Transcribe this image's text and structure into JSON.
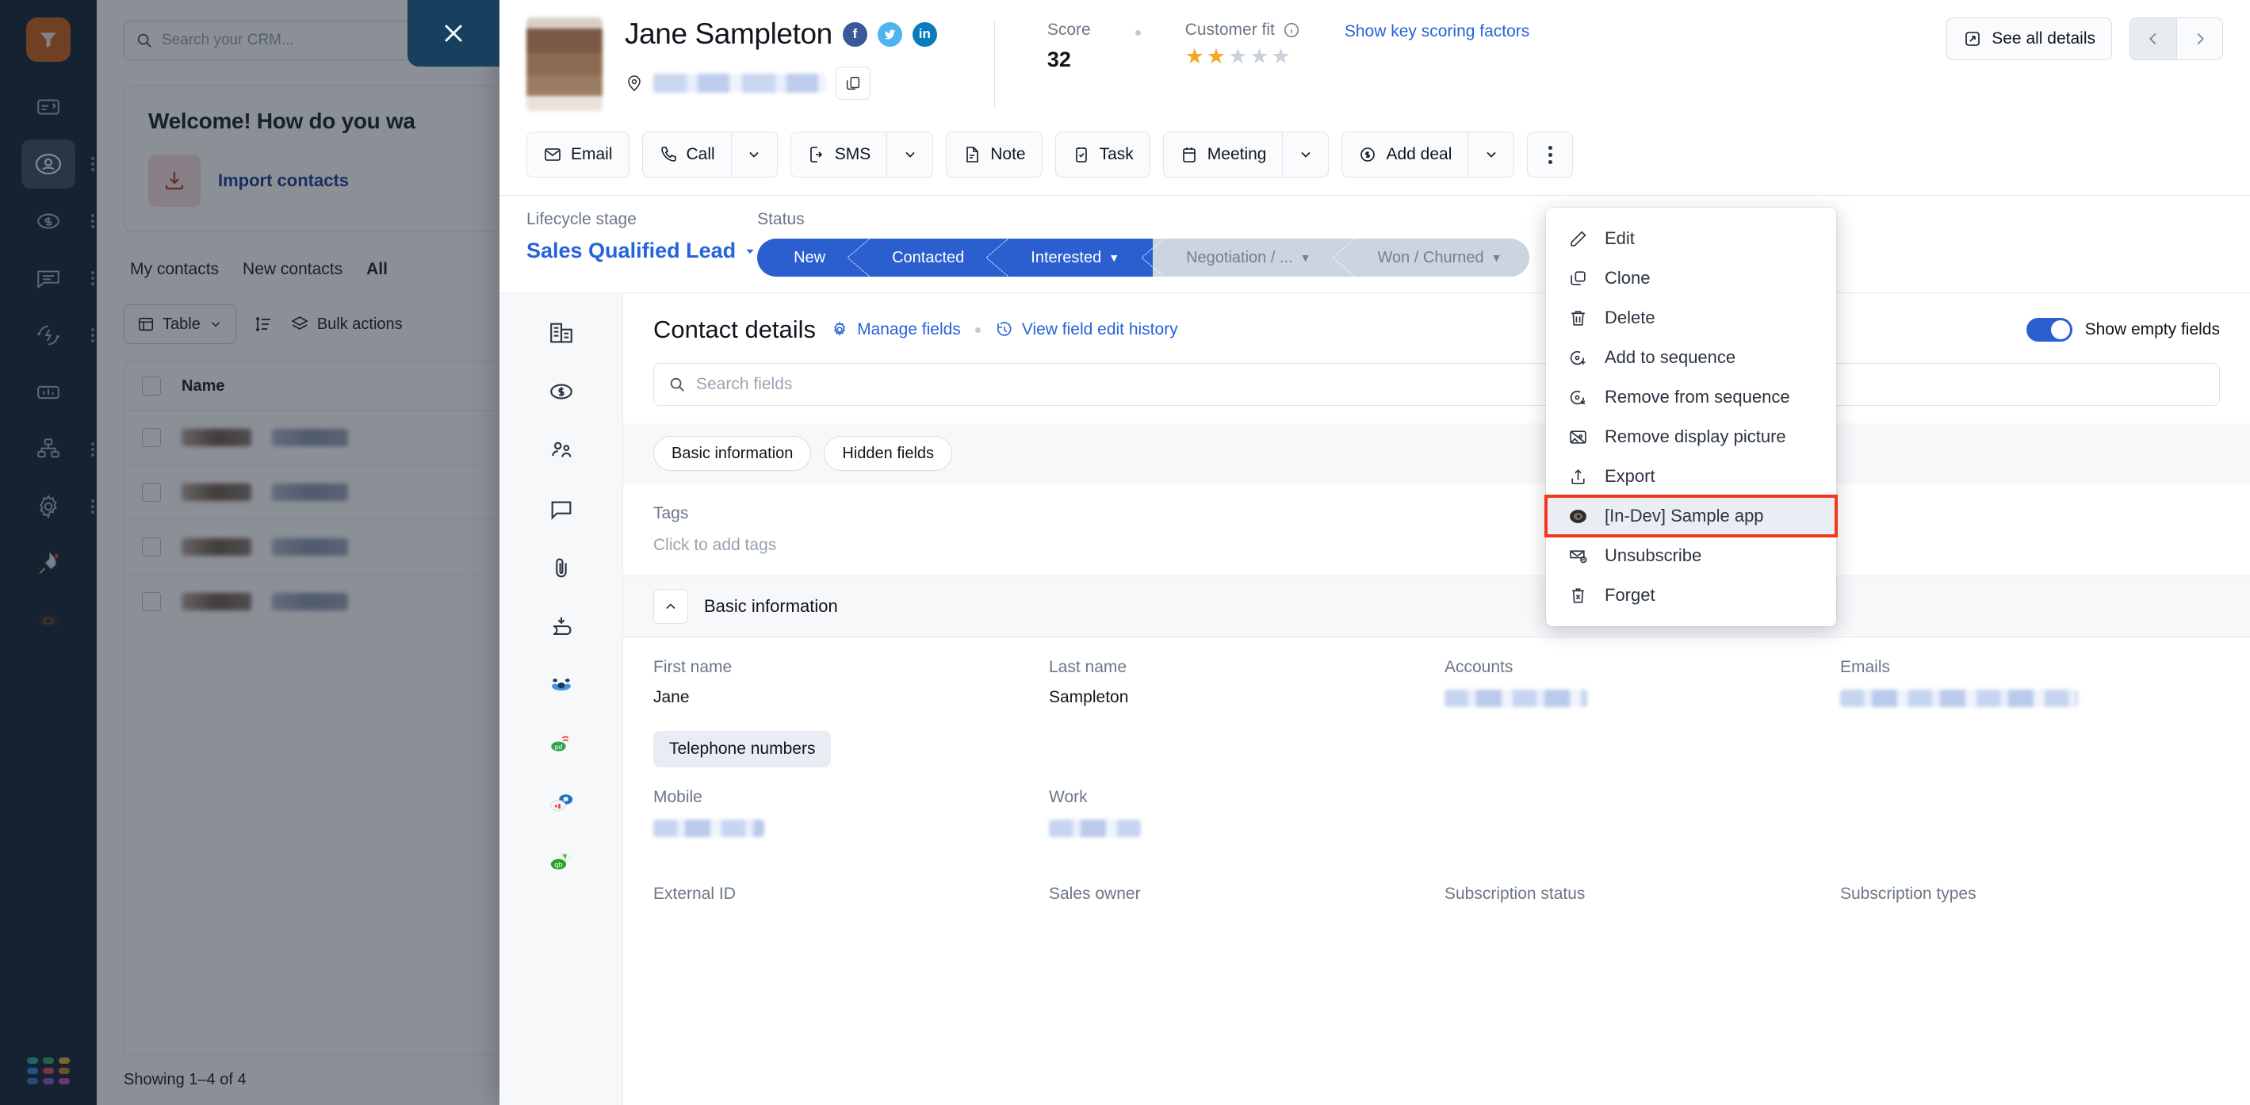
{
  "background_app": {
    "search": {
      "placeholder": "Search your CRM..."
    },
    "welcome": {
      "title": "Welcome! How do you wa",
      "import_label": "Import contacts"
    },
    "tabs": [
      {
        "label": "My contacts"
      },
      {
        "label": "New contacts"
      },
      {
        "label": "All"
      }
    ],
    "toolbar": {
      "view_label": "Table",
      "bulk_actions_label": "Bulk actions"
    },
    "table": {
      "columns": [
        "Name"
      ]
    },
    "footer": {
      "showing": "Showing 1–4 of 4"
    },
    "help_label": "?"
  },
  "modal": {
    "close_label": "×",
    "contact": {
      "name": "Jane Sampleton",
      "socials": [
        "facebook-icon",
        "twitter-icon",
        "linkedin-icon"
      ],
      "location_redacted": true
    },
    "score": {
      "label": "Score",
      "value": "32",
      "fit_label": "Customer fit",
      "fit_stars_filled": 2,
      "fit_stars_total": 5,
      "key_factors_link": "Show key scoring factors"
    },
    "header_buttons": {
      "see_all_details": "See all details",
      "prev": "‹",
      "next": "›"
    },
    "actions": [
      {
        "label": "Email",
        "icon": "mail-icon",
        "caret": false
      },
      {
        "label": "Call",
        "icon": "phone-icon",
        "caret": true
      },
      {
        "label": "SMS",
        "icon": "sms-icon",
        "caret": true
      },
      {
        "label": "Note",
        "icon": "note-icon",
        "caret": false
      },
      {
        "label": "Task",
        "icon": "task-icon",
        "caret": false
      },
      {
        "label": "Meeting",
        "icon": "calendar-icon",
        "caret": true
      },
      {
        "label": "Add deal",
        "icon": "deal-icon",
        "caret": true
      }
    ],
    "lifecycle": {
      "label": "Lifecycle stage",
      "value": "Sales Qualified Lead"
    },
    "status": {
      "label": "Status",
      "steps": [
        {
          "label": "New",
          "active": true,
          "caret": false
        },
        {
          "label": "Contacted",
          "active": true,
          "caret": false
        },
        {
          "label": "Interested",
          "active": true,
          "caret": true
        },
        {
          "label": "Negotiation / ...",
          "active": false,
          "caret": true
        },
        {
          "label": "Won / Churned",
          "active": false,
          "caret": true
        }
      ]
    },
    "details": {
      "title": "Contact details",
      "manage_fields": "Manage fields",
      "view_history": "View field edit history",
      "show_empty_fields_label": "Show empty fields",
      "show_empty_fields_on": true,
      "search_placeholder": "Search fields",
      "chips": [
        "Basic information",
        "Hidden fields"
      ],
      "tags": {
        "label": "Tags",
        "value": "Click to add tags"
      },
      "section": {
        "title": "Basic information"
      },
      "fields_row1": [
        {
          "label": "First name",
          "value": "Jane"
        },
        {
          "label": "Last name",
          "value": "Sampleton"
        },
        {
          "label": "Accounts",
          "value": null
        },
        {
          "label": "Emails",
          "value": null
        }
      ],
      "telephone_header": "Telephone numbers",
      "fields_row2": [
        {
          "label": "Mobile",
          "value": null
        },
        {
          "label": "Work",
          "value": null
        }
      ],
      "fields_row3": [
        {
          "label": "External ID",
          "value": null
        },
        {
          "label": "Sales owner",
          "value": null
        },
        {
          "label": "Subscription status",
          "value": null
        },
        {
          "label": "Subscription types",
          "value": null
        }
      ]
    }
  },
  "dropdown_menu": {
    "items": [
      {
        "label": "Edit",
        "icon": "pencil-icon",
        "highlighted": false
      },
      {
        "label": "Clone",
        "icon": "copy-icon",
        "highlighted": false
      },
      {
        "label": "Delete",
        "icon": "trash-icon",
        "highlighted": false
      },
      {
        "label": "Add to sequence",
        "icon": "add-sequence-icon",
        "highlighted": false
      },
      {
        "label": "Remove from sequence",
        "icon": "remove-sequence-icon",
        "highlighted": false
      },
      {
        "label": "Remove display picture",
        "icon": "remove-image-icon",
        "highlighted": false
      },
      {
        "label": "Export",
        "icon": "export-icon",
        "highlighted": false
      },
      {
        "label": "[In-Dev] Sample app",
        "icon": "sample-app-icon",
        "highlighted": true
      },
      {
        "label": "Unsubscribe",
        "icon": "unsubscribe-icon",
        "highlighted": false
      },
      {
        "label": "Forget",
        "icon": "forget-icon",
        "highlighted": false
      }
    ],
    "highlight_color": "#f4361b"
  },
  "colors": {
    "accent_blue": "#2563d9",
    "pipeline_active": "#2b5fd0",
    "pipeline_inactive": "#ccd4e0",
    "star_filled": "#f5a623",
    "rail_bg": "#132436",
    "logo_bg": "#c8601b"
  }
}
